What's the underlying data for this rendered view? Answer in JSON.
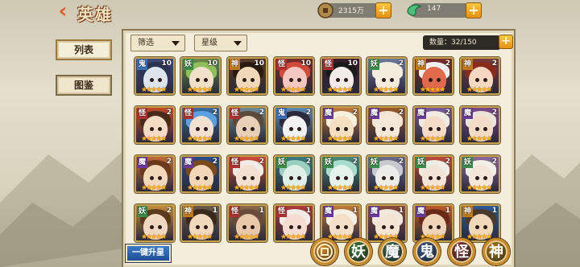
{
  "header": {
    "title": "英雄",
    "back_icon": "back-arrow-icon"
  },
  "resources": {
    "coins": {
      "value": "2315万",
      "icon": "coin-icon"
    },
    "jade": {
      "value": "147",
      "icon": "jade-icon"
    }
  },
  "sidebar": {
    "tabs": [
      {
        "label": "列表",
        "active": true
      },
      {
        "label": "图鉴",
        "active": false
      }
    ]
  },
  "filters": {
    "filter_label": "筛选",
    "star_label": "星级"
  },
  "capacity": {
    "label": "数量：32/150"
  },
  "heroes": [
    {
      "faction": "鬼",
      "level": "10",
      "stars": 5,
      "palette": [
        "#dde4ee",
        "#2a3550",
        "#3a4a7a"
      ]
    },
    {
      "faction": "妖",
      "level": "10",
      "stars": 5,
      "palette": [
        "#f2e0c8",
        "#8fbf5a",
        "#6a8a4a"
      ]
    },
    {
      "faction": "神",
      "level": "10",
      "stars": 5,
      "palette": [
        "#f0d8b8",
        "#2a1a10",
        "#5a3a2a"
      ]
    },
    {
      "faction": "怪",
      "level": "10",
      "stars": 5,
      "palette": [
        "#f4c8c0",
        "#d24a3a",
        "#7a2a2a"
      ]
    },
    {
      "faction": "怪",
      "level": "10",
      "stars": 5,
      "palette": [
        "#f2ece8",
        "#1a1a1a",
        "#3a1a2a"
      ]
    },
    {
      "faction": "妖",
      "level": "2",
      "stars": 5,
      "palette": [
        "#f6ecde",
        "#f4ecdc",
        "#6a7a9a"
      ]
    },
    {
      "faction": "神",
      "level": "2",
      "stars": 5,
      "palette": [
        "#e06a4a",
        "#f0f0f0",
        "#7a2a2a"
      ]
    },
    {
      "faction": "神",
      "level": "2",
      "stars": 5,
      "palette": [
        "#f4d8c0",
        "#8a2a1a",
        "#7a3a3a"
      ]
    },
    {
      "faction": "怪",
      "level": "2",
      "stars": 5,
      "palette": [
        "#f4dcc4",
        "#4a2a1a",
        "#c04a2a"
      ]
    },
    {
      "faction": "怪",
      "level": "2",
      "stars": 5,
      "palette": [
        "#f2e0d0",
        "#5aa0e0",
        "#3a6aa0"
      ]
    },
    {
      "faction": "怪",
      "level": "2",
      "stars": 5,
      "palette": [
        "#e8d0b8",
        "#5a4a3a",
        "#6a8a9a"
      ]
    },
    {
      "faction": "鬼",
      "level": "2",
      "stars": 5,
      "palette": [
        "#f2f2f2",
        "#2a2a3a",
        "#5a8ab0"
      ]
    },
    {
      "faction": "魔",
      "level": "2",
      "stars": 5,
      "palette": [
        "#f4e0c0",
        "#f6f0e0",
        "#c07a3a"
      ]
    },
    {
      "faction": "魔",
      "level": "2",
      "stars": 5,
      "palette": [
        "#f4e8d8",
        "#f2e6d8",
        "#9a5a2a"
      ]
    },
    {
      "faction": "魔",
      "level": "2",
      "stars": 5,
      "palette": [
        "#f4dcc8",
        "#f0ece4",
        "#7a5a9a"
      ]
    },
    {
      "faction": "魔",
      "level": "2",
      "stars": 5,
      "palette": [
        "#f2dcc8",
        "#ece4d8",
        "#7a4a8a"
      ]
    },
    {
      "faction": "魔",
      "level": "2",
      "stars": 5,
      "palette": [
        "#f0d8b8",
        "#6a3a1a",
        "#c06a3a"
      ]
    },
    {
      "faction": "魔",
      "level": "2",
      "stars": 5,
      "palette": [
        "#f2d8b8",
        "#7a4a1a",
        "#2a4a8a"
      ]
    },
    {
      "faction": "怪",
      "level": "2",
      "stars": 5,
      "palette": [
        "#f4e0d0",
        "#f2ece6",
        "#d04a3a"
      ]
    },
    {
      "faction": "妖",
      "level": "2",
      "stars": 5,
      "palette": [
        "#e0f0e8",
        "#9ad0c0",
        "#3a7a7a"
      ]
    },
    {
      "faction": "妖",
      "level": "2",
      "stars": 5,
      "palette": [
        "#e6f2ec",
        "#a8dccc",
        "#4a8a7a"
      ]
    },
    {
      "faction": "妖",
      "level": "2",
      "stars": 5,
      "palette": [
        "#ecece8",
        "#c8c8d0",
        "#6a6a8a"
      ]
    },
    {
      "faction": "妖",
      "level": "2",
      "stars": 5,
      "palette": [
        "#f4e4d8",
        "#f0ece6",
        "#c04a3a"
      ]
    },
    {
      "faction": "妖",
      "level": "2",
      "stars": 5,
      "palette": [
        "#f4e6d8",
        "#f2eee8",
        "#8a6a9a"
      ]
    },
    {
      "faction": "妖",
      "level": "2",
      "stars": 5,
      "palette": [
        "#f0d8c0",
        "#5a3a1a",
        "#c08a3a"
      ]
    },
    {
      "faction": "神",
      "level": "1",
      "stars": 5,
      "palette": [
        "#f0d8bc",
        "#3a2a1a",
        "#6a5a4a"
      ]
    },
    {
      "faction": "怪",
      "level": "1",
      "stars": 5,
      "palette": [
        "#e8c8a8",
        "#6a4a3a",
        "#8a6a4a"
      ]
    },
    {
      "faction": "怪",
      "level": "1",
      "stars": 5,
      "palette": [
        "#f4dcd0",
        "#f2ece8",
        "#b03a3a"
      ]
    },
    {
      "faction": "魔",
      "level": "1",
      "stars": 5,
      "palette": [
        "#f4e0c8",
        "#f6f0e4",
        "#c07a3a"
      ]
    },
    {
      "faction": "魔",
      "level": "1",
      "stars": 5,
      "palette": [
        "#f4e4d4",
        "#f0e8dc",
        "#8a4a3a"
      ]
    },
    {
      "faction": "魔",
      "level": "1",
      "stars": 5,
      "palette": [
        "#f0d4b8",
        "#6a2a1a",
        "#c05a2a"
      ]
    },
    {
      "faction": "神",
      "level": "1",
      "stars": 5,
      "palette": [
        "#f0d8b8",
        "#4a3a2a",
        "#2a5a9a"
      ]
    }
  ],
  "faction_colors": {
    "鬼": "#3b6fb8",
    "妖": "#3e8a4a",
    "神": "#c07a1a",
    "怪": "#b03030",
    "魔": "#6a3a9a"
  },
  "bottom": {
    "upstar_label": "一键升星",
    "faction_buttons": [
      {
        "label": "",
        "name": "faction-all-button",
        "color": "#d88a2a"
      },
      {
        "label": "妖",
        "name": "faction-yao-button",
        "color": "#3e7a3a"
      },
      {
        "label": "魔",
        "name": "faction-mo-button",
        "color": "#3a6a5a"
      },
      {
        "label": "鬼",
        "name": "faction-gui-button",
        "color": "#3a5a8a"
      },
      {
        "label": "怪",
        "name": "faction-guai-button",
        "color": "#8a3a3a"
      },
      {
        "label": "神",
        "name": "faction-shen-button",
        "color": "#b0801a"
      }
    ]
  }
}
